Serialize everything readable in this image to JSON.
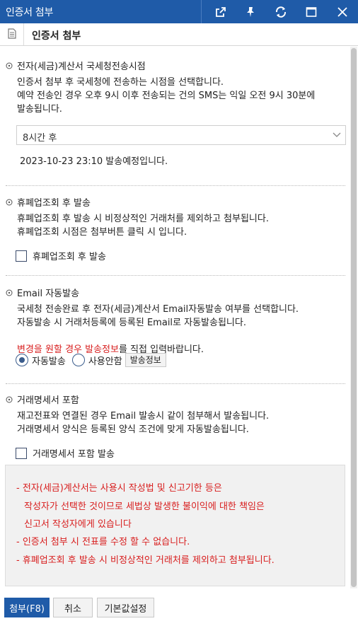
{
  "window": {
    "title": "인증서 첨부"
  },
  "header": {
    "title": "인증서 첨부"
  },
  "send_time": {
    "title": "전자(세금)계산서 국세청전송시점",
    "desc_lines": "인증서 첨부 후 국세청에 전송하는 시점을 선택합니다.\n예약 전송인 경우 오후 9시 이후 전송되는 건의 SMS는 익일 오전 9시 30분에\n발송됩니다.",
    "select_value": "8시간 후",
    "scheduled_text": "2023-10-23 23:10 발송예정입니다."
  },
  "closure_check": {
    "title": "휴폐업조회 후 발송",
    "desc_lines": "휴폐업조회 후 발송 시 비정상적인 거래처를 제외하고 첨부됩니다.\n휴폐업조회 시점은 첨부버튼 클릭 시 입니다.",
    "checkbox_label": "휴폐업조회 후 발송"
  },
  "email_auto": {
    "title": "Email 자동발송",
    "desc_lines": "국세청 전송완료 후 전자(세금)계산서 Email자동발송 여부를 선택합니다.\n자동발송 시 거래처등록에 등록된 Email로 자동발송됩니다.",
    "note_red": "변경을 원할 경우 발송정보",
    "note_black": "를 직접 입력바랍니다.",
    "radio_auto": "자동발송",
    "radio_none": "사용안함",
    "info_button": "발송정보"
  },
  "statement": {
    "title": "거래명세서 포함",
    "desc_lines": "재고전표와 연결된 경우 Email 발송시 같이 첨부해서 발송됩니다.\n거래명세서 양식은 등록된 양식 조건에 맞게 자동발송됩니다.",
    "checkbox_label": "거래명세서 포함 발송"
  },
  "notice": {
    "lines": [
      "- 전자(세금)계산서는 사용시 작성법 및 신고기한 등은",
      "작성자가 선택한 것이므로 세법상 발생한 불이익에 대한 책임은",
      "신고서 작성자에게 있습니다",
      "- 인증서 첨부 시 전표를 수정 할 수 없습니다.",
      "- 휴폐업조회 후 발송 시 비정상적인 거래처를 제외하고 첨부됩니다."
    ]
  },
  "footer": {
    "attach": "첨부(F8)",
    "cancel": "취소",
    "defaults": "기본값설정"
  },
  "colors": {
    "titlebar": "#1f5ba8",
    "warning": "#d81e1e"
  }
}
